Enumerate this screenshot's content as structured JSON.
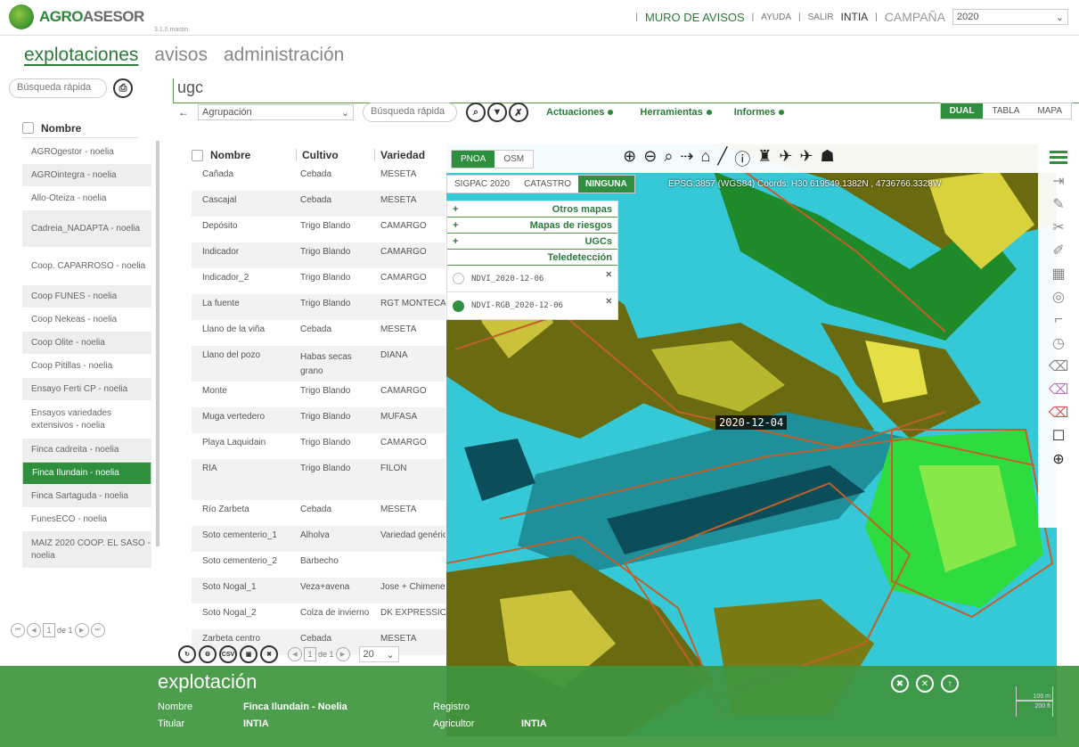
{
  "app": {
    "brand_a": "AGRO",
    "brand_b": "ASESOR",
    "version": "3.1.0.mastin"
  },
  "topnav": {
    "muro": "MURO DE AVISOS",
    "ayuda": "AYUDA",
    "salir": "SALIR",
    "org": "INTIA",
    "campana_label": "CAMPAÑA",
    "campana_value": "2020"
  },
  "mainnav": {
    "items": [
      "explotaciones",
      "avisos",
      "administración"
    ]
  },
  "left": {
    "search_placeholder": "Búsqueda rápida",
    "header": "Nombre",
    "items": [
      "AGROgestor - noelia",
      "AGROintegra - noelia",
      "Allo-Oteiza - noelia",
      "Cadreia_NADAPTA - noelia",
      "Coop. CAPARROSO - noelia",
      "Coop FUNES - noelia",
      "Coop Nekeas - noelia",
      "Coop Olite - noelia",
      "Coop Pitillas - noelia",
      "Ensayo Ferti CP - noelia",
      "Ensayos variedades extensivos - noelia",
      "Finca cadreita - noelia",
      "Finca Ilundain - noelia",
      "Finca Sartaguda - noelia",
      "FunesECO - noelia",
      "MAIZ 2020 COOP. EL SASO - noelia"
    ],
    "pager": {
      "page": "1",
      "of": "de 1"
    }
  },
  "ugc": {
    "title": "ugc"
  },
  "toolbar": {
    "agrupacion": "Agrupación",
    "search_placeholder": "Búsqueda rápida",
    "actuaciones": "Actuaciones",
    "herramientas": "Herramientas",
    "informes": "Informes",
    "views": [
      "DUAL",
      "TABLA",
      "MAPA"
    ]
  },
  "table": {
    "headers": [
      "Nombre",
      "Cultivo",
      "Variedad"
    ],
    "rows": [
      [
        "Cañada",
        "Cebada",
        "MESETA"
      ],
      [
        "Cascajal",
        "Cebada",
        "MESETA"
      ],
      [
        "Depósito",
        "Trigo Blando",
        "CAMARGO"
      ],
      [
        "Indicador",
        "Trigo Blando",
        "CAMARGO"
      ],
      [
        "Indicador_2",
        "Trigo Blando",
        "CAMARGO"
      ],
      [
        "La fuente",
        "Trigo Blando",
        "RGT MONTECARLO"
      ],
      [
        "Llano de la viña",
        "Cebada",
        "MESETA"
      ],
      [
        "Llano del pozo",
        "Habas secas grano",
        "DIANA"
      ],
      [
        "Monte",
        "Trigo Blando",
        "CAMARGO"
      ],
      [
        "Muga vertedero",
        "Trigo Blando",
        "MUFASA"
      ],
      [
        "Playa Laquidain",
        "Trigo Blando",
        "CAMARGO"
      ],
      [
        "RIA",
        "Trigo Blando",
        "FILON"
      ],
      [
        "Río Zarbeta",
        "Cebada",
        "MESETA"
      ],
      [
        "Soto cementerio_1",
        "Alholva",
        "Variedad genérica"
      ],
      [
        "Soto cementerio_2",
        "Barbecho",
        ""
      ],
      [
        "Soto Nogal_1",
        "Veza+avena",
        "Jose + Chimene"
      ],
      [
        "Soto Nogal_2",
        "Colza de invierno",
        "DK EXPRESSION"
      ],
      [
        "Zarbeta centro",
        "Cebada",
        "MESETA"
      ]
    ],
    "pager": {
      "page": "1",
      "of": "de 1",
      "size": "20"
    },
    "csv": "CSV"
  },
  "map": {
    "base": [
      "PNOA",
      "OSM"
    ],
    "layers": [
      "SIGPAC 2020",
      "CATASTRO",
      "NINGUNA"
    ],
    "coords": "EPSG:3857 (WGS84) Coords: H30 619549.1382N , 4736766.3328W",
    "panel": [
      "Otros mapas",
      "Mapas de riesgos",
      "UGCs",
      "Teledetección"
    ],
    "ndvi": [
      "NDVI_2020-12-06",
      "NDVI-RGB_2020-12-06"
    ],
    "date": "2020-12-04"
  },
  "footer": {
    "title": "explotación",
    "nombre_label": "Nombre",
    "nombre_value": "Finca Ilundain - Noelia",
    "titular_label": "Titular",
    "titular_value": "INTIA",
    "registro_label": "Registro",
    "agricultor_label": "Agricultor",
    "agricultor_value": "INTIA",
    "scale1": "100 m",
    "scale2": "200 ft"
  }
}
